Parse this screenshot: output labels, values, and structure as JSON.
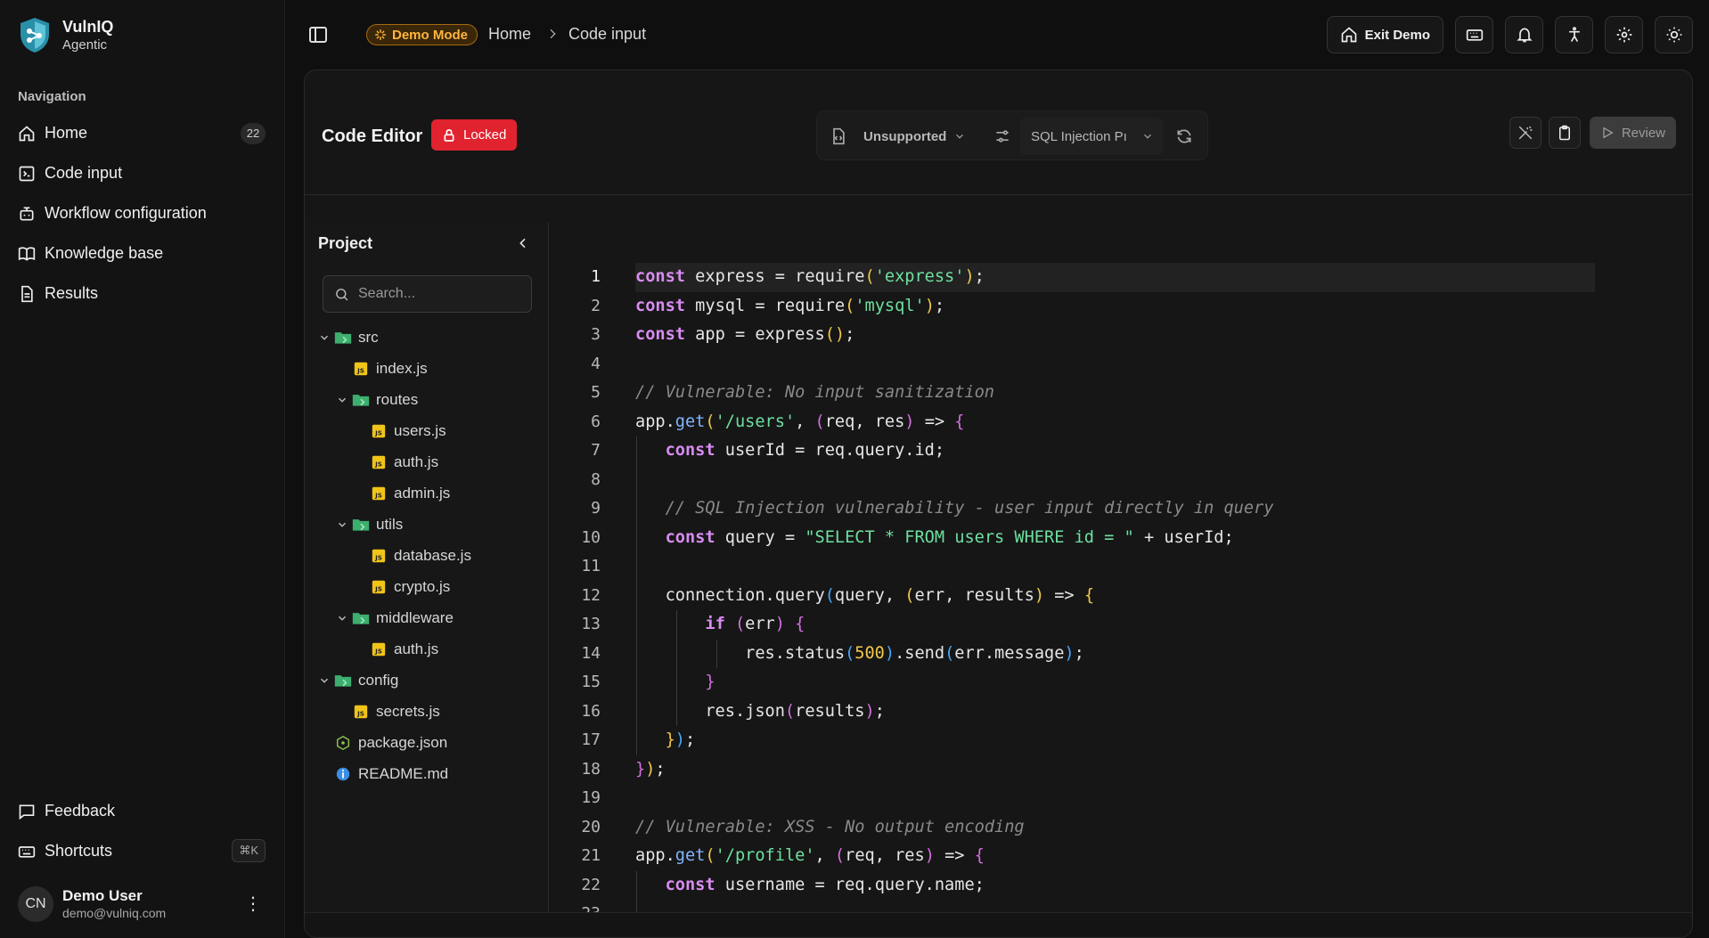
{
  "app": {
    "name": "VulnIQ",
    "subtitle": "Agentic"
  },
  "sidebar": {
    "heading": "Navigation",
    "items": [
      {
        "label": "Home",
        "icon": "home-icon",
        "badge": "22"
      },
      {
        "label": "Code input",
        "icon": "code-file-icon"
      },
      {
        "label": "Workflow configuration",
        "icon": "workflow-icon"
      },
      {
        "label": "Knowledge base",
        "icon": "book-icon"
      },
      {
        "label": "Results",
        "icon": "document-icon"
      }
    ],
    "bottom": [
      {
        "label": "Feedback",
        "icon": "message-icon"
      },
      {
        "label": "Shortcuts",
        "icon": "keyboard-icon",
        "kbd": "⌘K"
      }
    ],
    "user": {
      "initials": "CN",
      "name": "Demo User",
      "email": "demo@vulniq.com"
    }
  },
  "topbar": {
    "demo_label": "Demo Mode",
    "breadcrumb": [
      "Home",
      "Code input"
    ],
    "exit_label": "Exit Demo"
  },
  "editor": {
    "title": "Code Editor",
    "locked_label": "Locked",
    "language_select": "Unsupported",
    "vuln_select": "SQL Injection Pı",
    "review_label": "Review"
  },
  "project": {
    "title": "Project",
    "search_placeholder": "Search...",
    "tree": [
      {
        "name": "src",
        "type": "folder",
        "depth": 0
      },
      {
        "name": "index.js",
        "type": "js",
        "depth": 1
      },
      {
        "name": "routes",
        "type": "folder",
        "depth": 1
      },
      {
        "name": "users.js",
        "type": "js",
        "depth": 2
      },
      {
        "name": "auth.js",
        "type": "js",
        "depth": 2
      },
      {
        "name": "admin.js",
        "type": "js",
        "depth": 2
      },
      {
        "name": "utils",
        "type": "folder",
        "depth": 1
      },
      {
        "name": "database.js",
        "type": "js",
        "depth": 2
      },
      {
        "name": "crypto.js",
        "type": "js",
        "depth": 2
      },
      {
        "name": "middleware",
        "type": "folder",
        "depth": 1
      },
      {
        "name": "auth.js",
        "type": "js",
        "depth": 2
      },
      {
        "name": "config",
        "type": "folder",
        "depth": 0
      },
      {
        "name": "secrets.js",
        "type": "js",
        "depth": 1
      },
      {
        "name": "package.json",
        "type": "json",
        "depth": 0
      },
      {
        "name": "README.md",
        "type": "info",
        "depth": 0
      }
    ]
  },
  "code": {
    "current_line": 1,
    "lines": [
      [
        [
          "k",
          "const"
        ],
        [
          "",
          "  express = require"
        ],
        [
          "p1",
          "("
        ],
        [
          "s",
          "'express'"
        ],
        [
          "p1",
          ")"
        ],
        [
          "",
          ";"
        ]
      ],
      [
        [
          "k",
          "const"
        ],
        [
          "",
          "  mysql = require"
        ],
        [
          "p1",
          "("
        ],
        [
          "s",
          "'mysql'"
        ],
        [
          "p1",
          ")"
        ],
        [
          "",
          ";"
        ]
      ],
      [
        [
          "k",
          "const"
        ],
        [
          "",
          "  app = express"
        ],
        [
          "p1",
          "()"
        ],
        [
          "",
          ";"
        ]
      ],
      [],
      [
        [
          "c",
          "// Vulnerable: No input sanitization"
        ]
      ],
      [
        [
          "",
          "app."
        ],
        [
          "f",
          "get"
        ],
        [
          "p1",
          "("
        ],
        [
          "s",
          "'/users'"
        ],
        [
          "",
          ", "
        ],
        [
          "p2",
          "("
        ],
        [
          "",
          "req, res"
        ],
        [
          "p2",
          ")"
        ],
        [
          "",
          " => "
        ],
        [
          "p2",
          "{"
        ]
      ],
      [
        [
          "",
          "    "
        ],
        [
          "k",
          "const"
        ],
        [
          "",
          " userId = req.query.id;"
        ]
      ],
      [],
      [
        [
          "c",
          "    // SQL Injection vulnerability - user input directly in query"
        ]
      ],
      [
        [
          "",
          "    "
        ],
        [
          "k",
          "const"
        ],
        [
          "",
          " query = "
        ],
        [
          "s",
          "\"SELECT * FROM users WHERE id = \""
        ],
        [
          "",
          " + userId;"
        ]
      ],
      [],
      [
        [
          "",
          "    connection.query"
        ],
        [
          "p3",
          "("
        ],
        [
          "",
          "query, "
        ],
        [
          "p1",
          "("
        ],
        [
          "",
          "err, results"
        ],
        [
          "p1",
          ")"
        ],
        [
          "",
          " => "
        ],
        [
          "p1",
          "{"
        ]
      ],
      [
        [
          "",
          "        "
        ],
        [
          "k",
          "if"
        ],
        [
          "",
          " "
        ],
        [
          "p2",
          "("
        ],
        [
          "",
          "err"
        ],
        [
          "p2",
          ")"
        ],
        [
          "",
          " "
        ],
        [
          "p2",
          "{"
        ]
      ],
      [
        [
          "",
          "            res.status"
        ],
        [
          "p3",
          "("
        ],
        [
          "n",
          "500"
        ],
        [
          "p3",
          ")"
        ],
        [
          "",
          ".send"
        ],
        [
          "p3",
          "("
        ],
        [
          "",
          "err.message"
        ],
        [
          "p3",
          ")"
        ],
        [
          "",
          ";"
        ]
      ],
      [
        [
          "",
          "        "
        ],
        [
          "p2",
          "}"
        ]
      ],
      [
        [
          "",
          "        res.json"
        ],
        [
          "p2",
          "("
        ],
        [
          "",
          "results"
        ],
        [
          "p2",
          ")"
        ],
        [
          "",
          ";"
        ]
      ],
      [
        [
          "",
          "    "
        ],
        [
          "p1",
          "}"
        ],
        [
          "p3",
          ")"
        ],
        [
          "",
          ";"
        ]
      ],
      [
        [
          "p2",
          "}"
        ],
        [
          "p1",
          ")"
        ],
        [
          "",
          ";"
        ]
      ],
      [],
      [
        [
          "c",
          "// Vulnerable: XSS - No output encoding"
        ]
      ],
      [
        [
          "",
          "app."
        ],
        [
          "f",
          "get"
        ],
        [
          "p1",
          "("
        ],
        [
          "s",
          "'/profile'"
        ],
        [
          "",
          ", "
        ],
        [
          "p2",
          "("
        ],
        [
          "",
          "req, res"
        ],
        [
          "p2",
          ")"
        ],
        [
          "",
          " => "
        ],
        [
          "p2",
          "{"
        ]
      ],
      [
        [
          "",
          "    "
        ],
        [
          "k",
          "const"
        ],
        [
          "",
          " username = req.query.name;"
        ]
      ],
      []
    ]
  },
  "colors": {
    "accent_locked": "#e0232f",
    "demo_pill": "#ffb640",
    "keyword": "#d98cf2",
    "string": "#6ee0a0"
  }
}
